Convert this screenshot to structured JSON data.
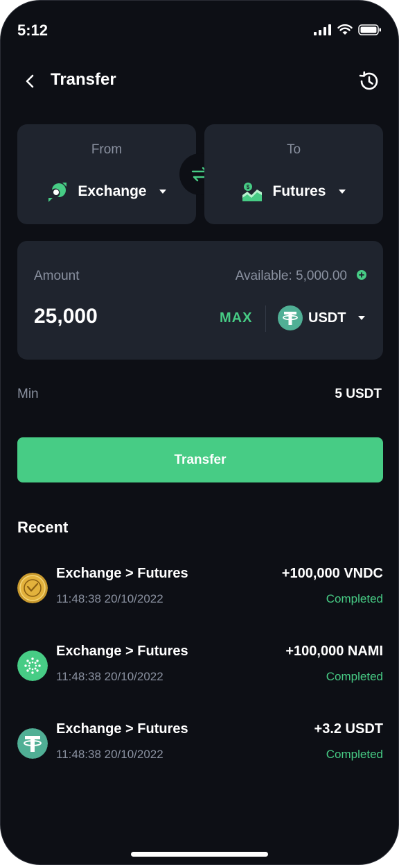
{
  "status_bar": {
    "time": "5:12"
  },
  "header": {
    "title": "Transfer"
  },
  "from_card": {
    "caption": "From",
    "wallet": "Exchange"
  },
  "to_card": {
    "caption": "To",
    "wallet": "Futures"
  },
  "amount": {
    "label": "Amount",
    "available": "Available: 5,000.00",
    "value": "25,000",
    "max_label": "MAX",
    "coin": "USDT"
  },
  "min": {
    "label": "Min",
    "value": "5 USDT"
  },
  "transfer_button": "Transfer",
  "recent": {
    "title": "Recent",
    "items": [
      {
        "title": "Exchange > Futures",
        "time": "11:48:38 20/10/2022",
        "amount": "+100,000 VNDC",
        "status": "Completed",
        "icon": "vndc-coin-icon"
      },
      {
        "title": "Exchange > Futures",
        "time": "11:48:38 20/10/2022",
        "amount": "+100,000 NAMI",
        "status": "Completed",
        "icon": "nami-coin-icon"
      },
      {
        "title": "Exchange > Futures",
        "time": "11:48:38 20/10/2022",
        "amount": "+3.2 USDT",
        "status": "Completed",
        "icon": "usdt-coin-icon"
      }
    ]
  },
  "colors": {
    "background": "#0d0f15",
    "card": "#1f242e",
    "accent": "#47cc85",
    "muted_text": "#8a91a0",
    "vndc_gold": "#e3b23c",
    "usdt_teal": "#50af95"
  }
}
